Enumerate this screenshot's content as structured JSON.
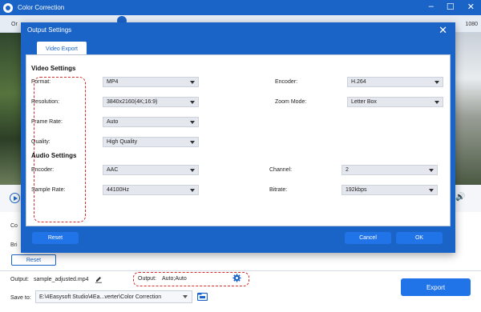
{
  "app": {
    "title": "Color Correction",
    "strip_left": "Or",
    "strip_right": "1080",
    "label_co": "Co",
    "label_bri": "Bri",
    "reset_label": "Reset"
  },
  "bottom": {
    "output_label": "Output:",
    "output_file": "sample_adjusted.mp4",
    "format_output_label": "Output:",
    "format_output_value": "Auto;Auto",
    "save_to_label": "Save to:",
    "save_to_path": "E:\\4Easysoft Studio\\4Ea...verter\\Color Correction",
    "export_label": "Export"
  },
  "dialog": {
    "title": "Output Settings",
    "tab_label": "Video Export",
    "video_section": "Video Settings",
    "audio_section": "Audio Settings",
    "video": {
      "format_label": "Format:",
      "format_value": "MP4",
      "resolution_label": "Resolution:",
      "resolution_value": "3840x2160(4K;16:9)",
      "framerate_label": "Frame Rate:",
      "framerate_value": "Auto",
      "quality_label": "Quality:",
      "quality_value": "High Quality",
      "encoder_label": "Encoder:",
      "encoder_value": "H.264",
      "zoom_label": "Zoom Mode:",
      "zoom_value": "Letter Box"
    },
    "audio": {
      "encoder_label": "Encoder:",
      "encoder_value": "AAC",
      "samplerate_label": "Sample Rate:",
      "samplerate_value": "44100Hz",
      "channel_label": "Channel:",
      "channel_value": "2",
      "bitrate_label": "Bitrate:",
      "bitrate_value": "192kbps"
    },
    "reset_label": "Reset",
    "cancel_label": "Cancel",
    "ok_label": "OK"
  },
  "colors": {
    "brand_blue": "#1b64c7",
    "button_blue": "#2174e8",
    "highlight_red": "#d42c2c"
  }
}
